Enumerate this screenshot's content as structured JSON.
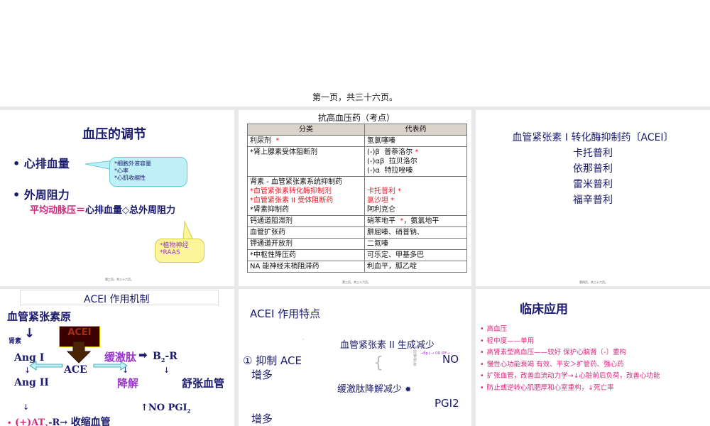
{
  "top": {
    "caption": "第一页，共三十六页。"
  },
  "slide1": {
    "title": "血压的调节",
    "bullet1": "• 心排血量",
    "bullet2": "• 外周阻力",
    "formula_lhs": "平均动脉压＝",
    "formula_rhs": "心排血量◇总外周阻力",
    "bubble1": [
      "*细胞外液容量",
      "*心率",
      "*心肌收缩性"
    ],
    "bubble2": [
      "*植物神经",
      "*RAAS"
    ],
    "footer": "第二页，共三十六页。"
  },
  "slide2": {
    "title": "抗高血压药（考点）",
    "headers": [
      "分类",
      "代表药"
    ],
    "rows": [
      {
        "cat": [
          {
            "t": "利尿剂  ",
            "c": "k"
          },
          {
            "t": "*",
            "c": "r"
          }
        ],
        "drug": [
          {
            "t": "氢氯噻嗪",
            "c": "k"
          }
        ]
      },
      {
        "cat": [
          {
            "t": "*肾上腺素受体阻断剂",
            "c": "k"
          }
        ],
        "drug": [
          {
            "t": "(-)β  普萘洛尔 ",
            "c": "k"
          },
          {
            "t": "*",
            "c": "r"
          },
          {
            "t": "\n(-)αβ  拉贝洛尔\n(-)α  特拉唑嗪",
            "c": "k"
          }
        ]
      },
      {
        "cat": [
          {
            "t": "肾素 - 血管紧张素系统抑制药\n",
            "c": "k"
          },
          {
            "t": "*血管紧张素转化酶抑制剂\n*血管紧张素 II 受体阻断药\n",
            "c": "r"
          },
          {
            "t": "*肾素抑制药",
            "c": "k"
          }
        ],
        "drug": [
          {
            "t": "\n卡托普利 *\n氯沙坦 *\n",
            "c": "r"
          },
          {
            "t": "阿利克仑",
            "c": "k"
          }
        ]
      },
      {
        "cat": [
          {
            "t": "钙通道阻滞剂",
            "c": "k"
          }
        ],
        "drug": [
          {
            "t": "硝苯地平  ",
            "c": "k"
          },
          {
            "t": "*",
            "c": "r"
          },
          {
            "t": "，氨氯地平",
            "c": "k"
          }
        ]
      },
      {
        "cat": [
          {
            "t": "血管扩张药",
            "c": "k"
          }
        ],
        "drug": [
          {
            "t": "肼屈嗪、硝普钠、",
            "c": "k"
          }
        ]
      },
      {
        "cat": [
          {
            "t": "钾通道开放剂",
            "c": "k"
          }
        ],
        "drug": [
          {
            "t": "二氮嗪",
            "c": "k"
          }
        ]
      },
      {
        "cat": [
          {
            "t": "*中枢性降压药",
            "c": "k"
          }
        ],
        "drug": [
          {
            "t": "可乐定、甲基多巴",
            "c": "k"
          }
        ]
      },
      {
        "cat": [
          {
            "t": "NA 能神经末梢阻滞药",
            "c": "k"
          }
        ],
        "drug": [
          {
            "t": "利血平，胍乙啶",
            "c": "k"
          }
        ]
      }
    ],
    "footer": "第三页，共三十六页。"
  },
  "slide3": {
    "title": "血管紧张素 I 转化酶抑制药〔ACEI〕",
    "drugs": [
      "卡托普利",
      "依那普利",
      "雷米普利",
      "福辛普利"
    ],
    "footer": "第四页，共三十六页。"
  },
  "slide4": {
    "title": "ACEI 作用机制",
    "angiotensinogen": "血管紧张素原",
    "renin": "肾素",
    "acei_box": "ACEI",
    "ang1": "Ang I",
    "ace": "ACE",
    "ang2": "Ang II",
    "bradykinin": "缓激肽",
    "b2r": "B",
    "b2r_sub": "2",
    "b2r_tail": "-R",
    "degrade": "降解",
    "vasodilate": "舒张血管",
    "down_arrow": "↓",
    "no_pgi": "↑NO PGI",
    "no_pgi_sub": "2",
    "at_r": "(+)AT",
    "at_r_sub": "1",
    "at_r_tail": "-R→",
    "vasoconstrict": "收缩血管"
  },
  "slide5": {
    "title": "ACEI 作用特点",
    "point1": "① 抑制 ACE",
    "increase1": "增多",
    "ang2_decrease": "血管紧张素 II 生成减少",
    "bradykinin_decrease": "缓激肽降解减少",
    "no": "NO",
    "pgi2": "PGI2",
    "increase2": "增多",
    "tiny_side": "血管舒张",
    "tiny_mid": "→Bp↓→ OR IPF→"
  },
  "slide6": {
    "title": "临床应用",
    "items": [
      "高血压",
      "轻中度——单用",
      "高肾素型高血压——较好  保护心脑肾〔-〕重构",
      "慢性心功能衰竭  有效、平安＞扩管药、强心药",
      "扩张血管，改善血流动力学→↓心脏前后负荷，改善心功能",
      "防止或逆转心肌肥厚和心室重构，↓死亡率"
    ]
  }
}
